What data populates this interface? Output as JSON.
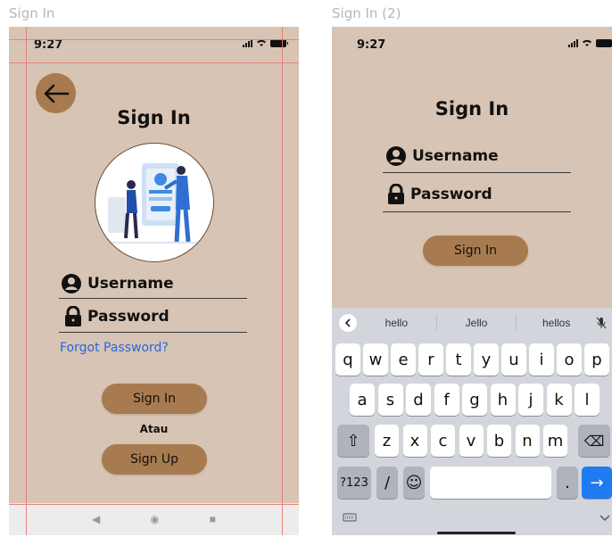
{
  "frames": [
    {
      "label": "Sign In",
      "status": {
        "time": "9:27"
      },
      "title": "Sign In",
      "username_label": "Username",
      "password_label": "Password",
      "forgot_password": "Forgot Password?",
      "signin_button": "Sign In",
      "or_text": "Atau",
      "signup_button": "Sign Up",
      "nav": {
        "back": "◀",
        "home": "◉",
        "recent": "■"
      }
    },
    {
      "label": "Sign In (2)",
      "status": {
        "time": "9:27"
      },
      "title": "Sign In",
      "username_label": "Username",
      "password_label": "Password",
      "signin_button": "Sign In",
      "keyboard": {
        "suggestions": [
          "hello",
          "Jello",
          "hellos"
        ],
        "row1": [
          "q",
          "w",
          "e",
          "r",
          "t",
          "y",
          "u",
          "i",
          "o",
          "p"
        ],
        "row2": [
          "a",
          "s",
          "d",
          "f",
          "g",
          "h",
          "j",
          "k",
          "l"
        ],
        "row3": [
          "z",
          "x",
          "c",
          "v",
          "b",
          "n",
          "m"
        ],
        "numbers_key": "?123",
        "slash_key": "/",
        "period_key": ".",
        "emoji_icon": "☺",
        "enter_icon": "→",
        "shift_icon": "⇧",
        "backspace_icon": "⌫"
      }
    }
  ],
  "colors": {
    "background": "#d8c4b4",
    "accent": "#a77b4f",
    "link": "#2a66d9",
    "guide": "#e57c72"
  }
}
